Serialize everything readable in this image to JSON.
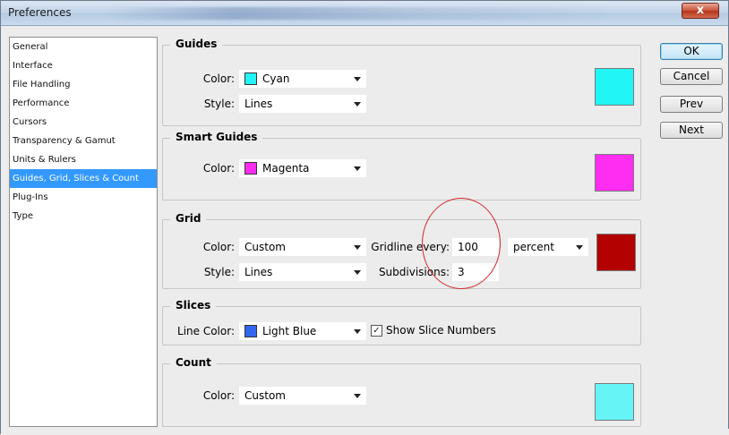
{
  "window": {
    "title": "Preferences",
    "close_label": "x"
  },
  "sidebar": {
    "items": [
      {
        "label": "General"
      },
      {
        "label": "Interface"
      },
      {
        "label": "File Handling"
      },
      {
        "label": "Performance"
      },
      {
        "label": "Cursors"
      },
      {
        "label": "Transparency & Gamut"
      },
      {
        "label": "Units & Rulers"
      },
      {
        "label": "Guides, Grid, Slices & Count"
      },
      {
        "label": "Plug-Ins"
      },
      {
        "label": "Type"
      }
    ],
    "selected_index": 7
  },
  "buttons": {
    "ok": "OK",
    "cancel": "Cancel",
    "prev": "Prev",
    "next": "Next"
  },
  "guides": {
    "title": "Guides",
    "color_label": "Color:",
    "color_value": "Cyan",
    "color_hex": "#22f5f5",
    "style_label": "Style:",
    "style_value": "Lines"
  },
  "smart_guides": {
    "title": "Smart Guides",
    "color_label": "Color:",
    "color_value": "Magenta",
    "color_hex": "#ff2cf2"
  },
  "grid": {
    "title": "Grid",
    "color_label": "Color:",
    "color_value": "Custom",
    "color_hex": "#b30000",
    "style_label": "Style:",
    "style_value": "Lines",
    "gridline_label": "Gridline every:",
    "gridline_value": "100",
    "unit_value": "percent",
    "subdivisions_label": "Subdivisions:",
    "subdivisions_value": "3"
  },
  "slices": {
    "title": "Slices",
    "line_color_label": "Line Color:",
    "line_color_value": "Light Blue",
    "line_color_hex": "#3366ee",
    "show_numbers_label": "Show Slice Numbers",
    "show_numbers_checked": true
  },
  "count": {
    "title": "Count",
    "color_label": "Color:",
    "color_value": "Custom",
    "color_hex": "#66f4f6"
  }
}
